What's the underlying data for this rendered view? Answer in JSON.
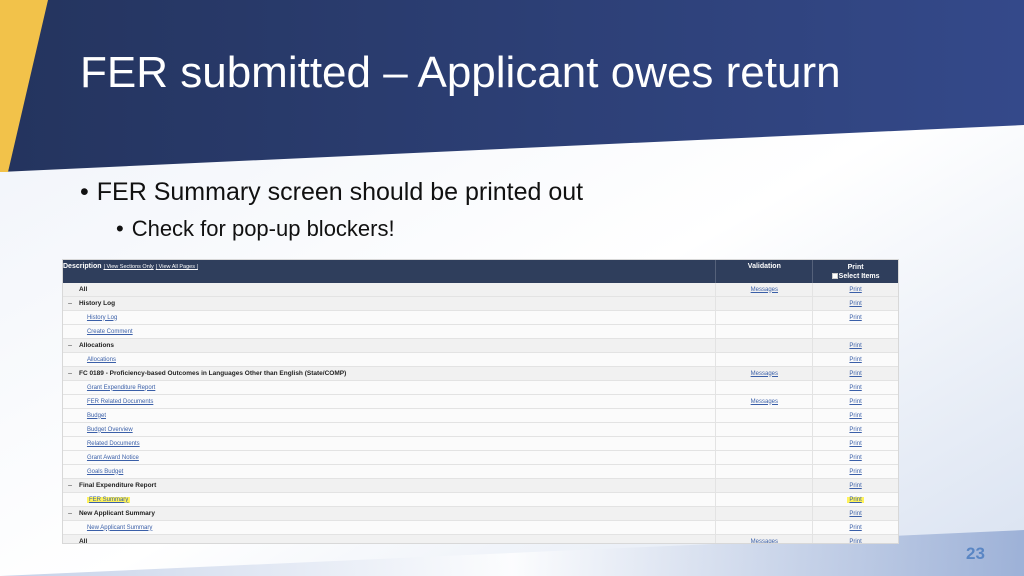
{
  "slide": {
    "title": "FER submitted – Applicant owes return",
    "bullets": [
      "FER Summary screen should be printed out",
      "Check for pop-up blockers!"
    ],
    "page_number": "23"
  },
  "colors": {
    "title_band": "#2b3d6b",
    "accent_gold": "#f2c24a",
    "table_header": "#2f3e5c",
    "highlight": "#fff35a",
    "link": "#3a5fa8"
  },
  "table": {
    "header": {
      "description": "Description",
      "view_sections_only": "View Sections Only",
      "view_all_pages": "View All Pages",
      "validation": "Validation",
      "print": "Print",
      "select_items": "Select Items"
    },
    "rows": [
      {
        "type": "sub-top",
        "label": "All",
        "toggle": "",
        "validation": "Messages",
        "print": "Print"
      },
      {
        "type": "group",
        "label": "History Log",
        "toggle": "−",
        "validation": "",
        "print": "Print"
      },
      {
        "type": "sub",
        "label": "History Log",
        "toggle": "",
        "validation": "",
        "print": "Print"
      },
      {
        "type": "sub",
        "label": "Create Comment",
        "toggle": "",
        "validation": "",
        "print": ""
      },
      {
        "type": "group",
        "label": "Allocations",
        "toggle": "−",
        "validation": "",
        "print": "Print"
      },
      {
        "type": "sub",
        "label": "Allocations",
        "toggle": "",
        "validation": "",
        "print": "Print"
      },
      {
        "type": "group",
        "label": "FC 0189 - Proficiency-based Outcomes in Languages Other than English (State/COMP)",
        "toggle": "−",
        "validation": "Messages",
        "print": "Print"
      },
      {
        "type": "sub",
        "label": "Grant Expenditure Report",
        "toggle": "",
        "validation": "",
        "print": "Print"
      },
      {
        "type": "sub",
        "label": "FER Related Documents",
        "toggle": "",
        "validation": "Messages",
        "print": "Print"
      },
      {
        "type": "sub",
        "label": "Budget",
        "toggle": "",
        "validation": "",
        "print": "Print"
      },
      {
        "type": "sub",
        "label": "Budget Overview",
        "toggle": "",
        "validation": "",
        "print": "Print"
      },
      {
        "type": "sub",
        "label": "Related Documents",
        "toggle": "",
        "validation": "",
        "print": "Print"
      },
      {
        "type": "sub",
        "label": "Grant Award Notice",
        "toggle": "",
        "validation": "",
        "print": "Print"
      },
      {
        "type": "sub",
        "label": "Goals Budget",
        "toggle": "",
        "validation": "",
        "print": "Print"
      },
      {
        "type": "group",
        "label": "Final Expenditure Report",
        "toggle": "−",
        "validation": "",
        "print": "Print"
      },
      {
        "type": "sub",
        "label": "FER Summary",
        "toggle": "",
        "validation": "",
        "print": "Print",
        "highlight": true
      },
      {
        "type": "group",
        "label": "New Applicant Summary",
        "toggle": "−",
        "validation": "",
        "print": "Print"
      },
      {
        "type": "sub",
        "label": "New Applicant Summary",
        "toggle": "",
        "validation": "",
        "print": "Print"
      },
      {
        "type": "group",
        "label": "All",
        "toggle": "",
        "validation": "Messages",
        "print": "Print"
      }
    ]
  }
}
